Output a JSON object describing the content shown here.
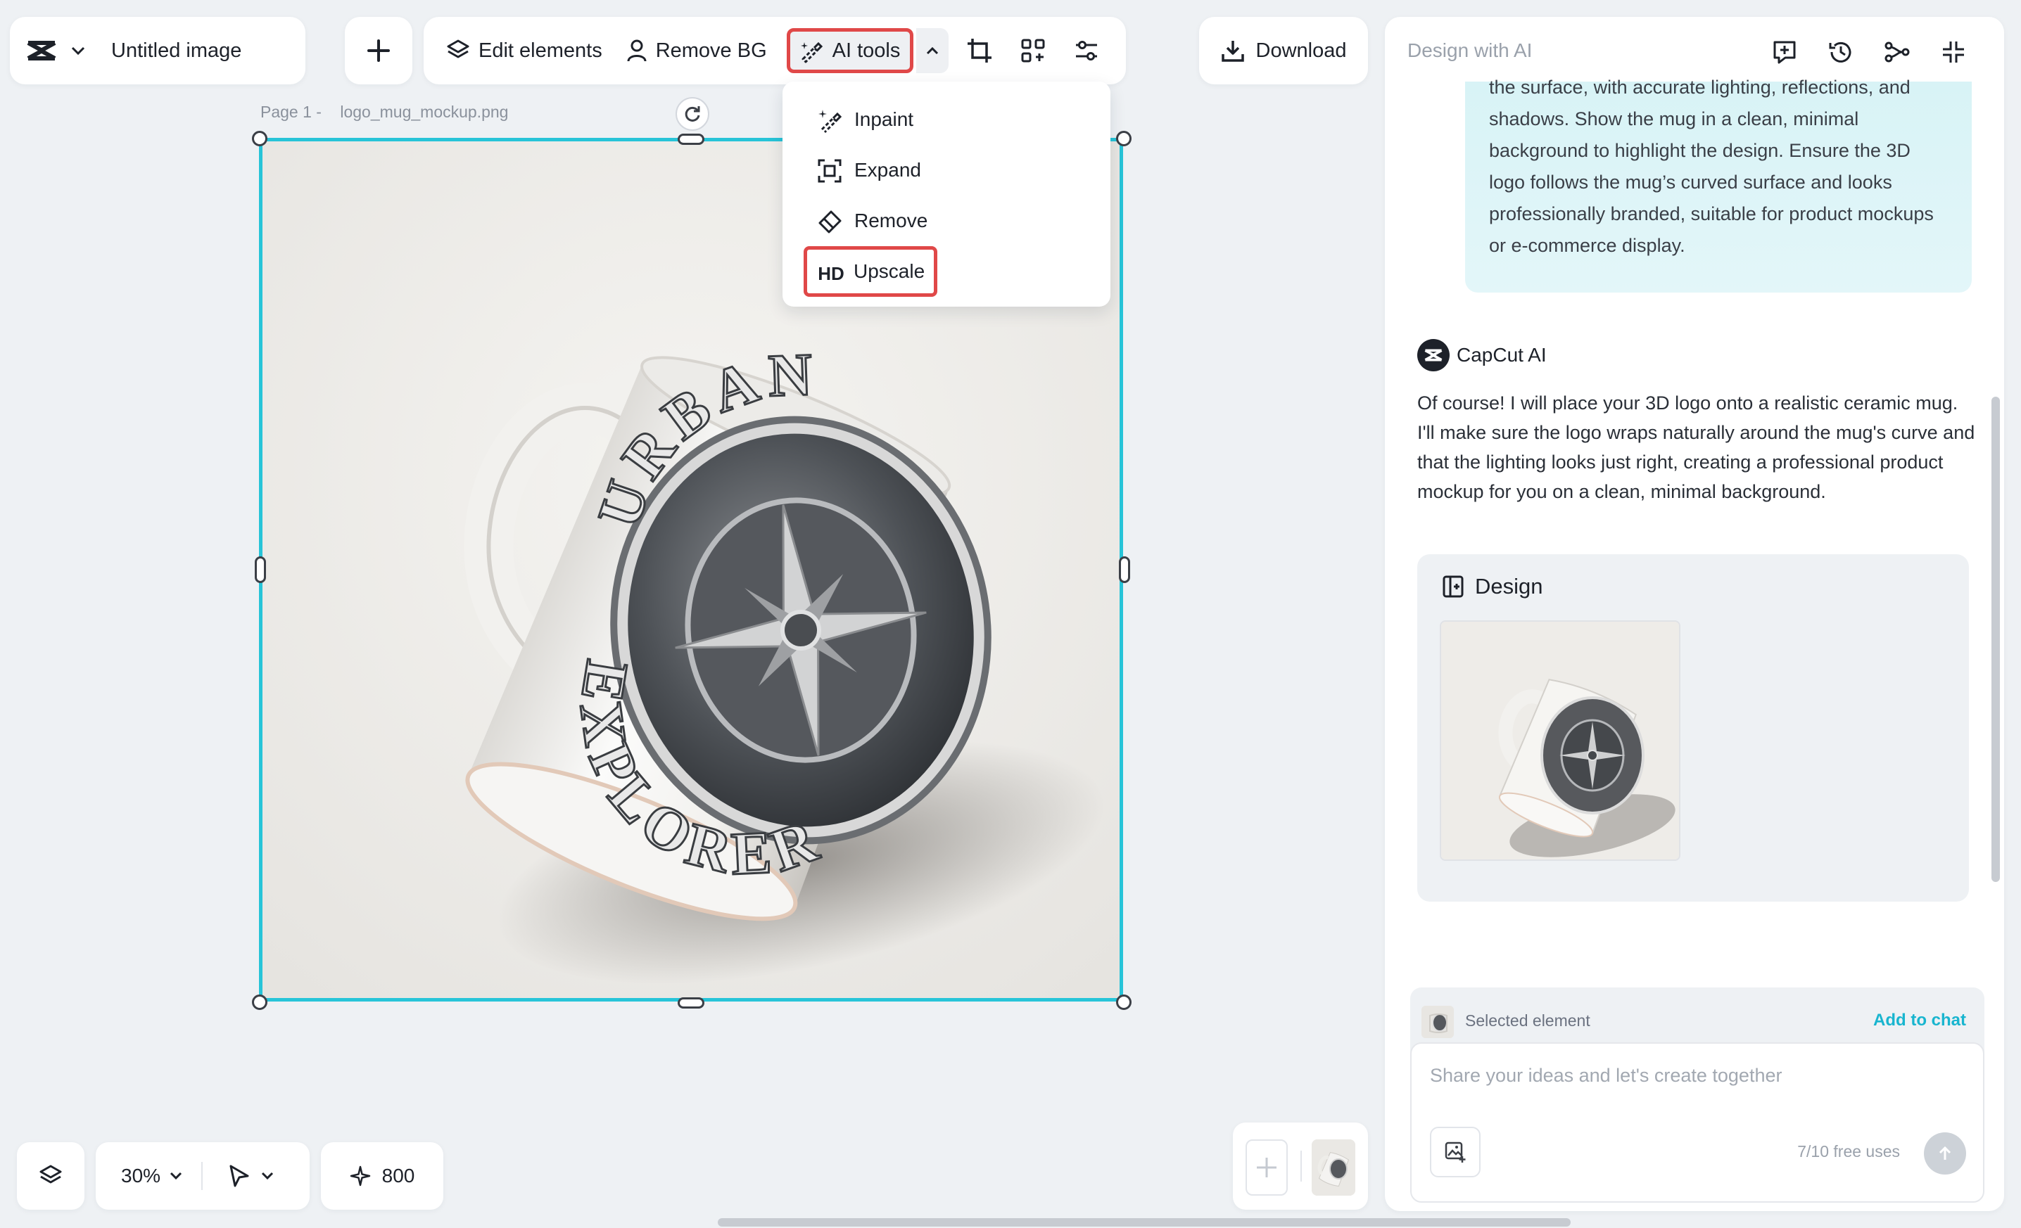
{
  "app": {
    "document_title": "Untitled image"
  },
  "toolbar": {
    "edit_elements_label": "Edit elements",
    "remove_bg_label": "Remove BG",
    "ai_tools_label": "AI tools",
    "download_label": "Download"
  },
  "ai_tools_menu": {
    "items": [
      {
        "label": "Inpaint",
        "icon": "brush-sparkle-icon"
      },
      {
        "label": "Expand",
        "icon": "expand-frame-icon"
      },
      {
        "label": "Remove",
        "icon": "eraser-icon"
      },
      {
        "label": "Upscale",
        "icon_text": "HD"
      }
    ]
  },
  "canvas": {
    "page_label": "Page 1 -",
    "file_name": "logo_mug_mockup.png",
    "logo_text_top": "URBAN",
    "logo_text_bottom": "EXPLORER"
  },
  "bottom_bar": {
    "zoom": "30%",
    "credits": "800"
  },
  "panel": {
    "title": "Design with AI",
    "user_message": "the surface, with accurate lighting, reflections, and shadows. Show the mug in a clean, minimal background to highlight the design. Ensure the 3D logo follows the mug’s curved surface and looks professionally branded, suitable for product mockups or e-commerce display.",
    "assistant_name": "CapCut AI",
    "assistant_message": "Of course! I will place your 3D logo onto a realistic ceramic mug. I'll make sure the logo wraps naturally around the mug's curve and that the lighting looks just right, creating a professional product mockup for you on a clean, minimal background.",
    "design_card_title": "Design",
    "selected_element_label": "Selected element",
    "add_to_chat_label": "Add to chat",
    "input_placeholder": "Share your ideas and let's create together",
    "free_uses": "7/10 free uses"
  },
  "colors": {
    "accent_cyan": "#27c4d8",
    "highlight_red": "#e04848",
    "link_cyan": "#18b5cf",
    "background": "#eef1f4"
  }
}
